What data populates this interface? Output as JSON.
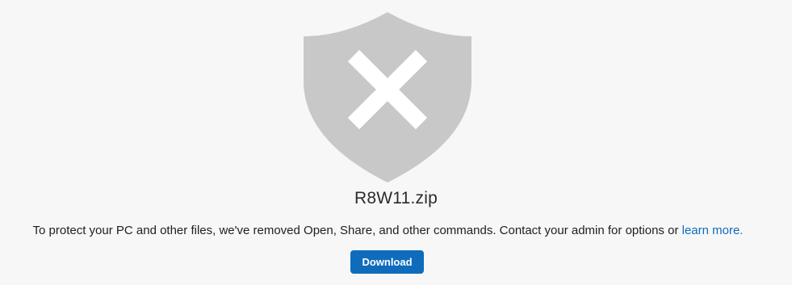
{
  "file": {
    "name": "R8W11.zip",
    "icon": "blocked-shield-icon"
  },
  "message": {
    "text": "To protect your PC and other files, we've removed Open, Share, and other commands. Contact your admin for options or ",
    "link_label": "learn more."
  },
  "actions": {
    "download_label": "Download"
  },
  "colors": {
    "background": "#f7f7f7",
    "shield": "#c8c8c8",
    "accent": "#0f6cbd"
  }
}
